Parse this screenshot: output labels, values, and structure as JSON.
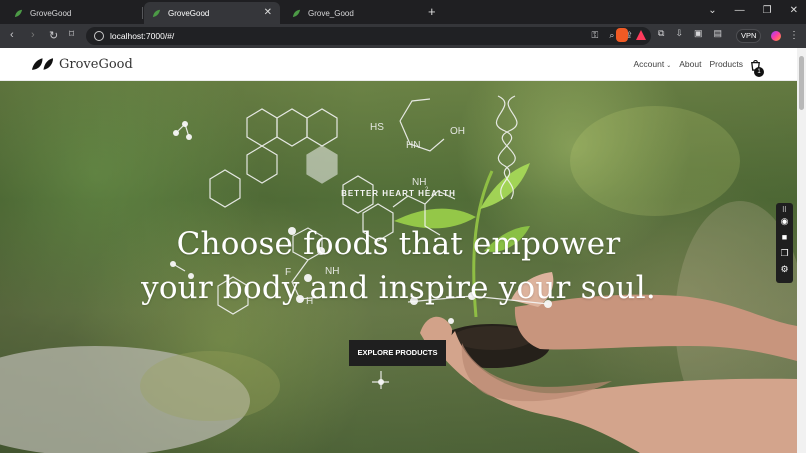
{
  "browser": {
    "tabs": [
      {
        "label": "GroveGood",
        "active": false
      },
      {
        "label": "GroveGood",
        "active": true
      },
      {
        "label": "Grove_Good",
        "active": false
      }
    ],
    "new_tab_label": "+",
    "url": "localhost:7000/#/",
    "vpn_label": "VPN",
    "controls": {
      "minimize": "—",
      "restore": "❐",
      "close": "✕",
      "chevron": "⌄",
      "menu": "⋮"
    }
  },
  "site": {
    "brand": "GroveGood",
    "nav": {
      "account": "Account",
      "about": "About",
      "products": "Products"
    },
    "cart_count": "1",
    "hero": {
      "eyebrow": "BETTER HEART HEALTH",
      "headline_line1": "Choose foods that empower",
      "headline_line2": "your body and inspire your soul.",
      "cta": "EXPLORE PRODUCTS"
    }
  },
  "colors": {
    "brand_green": "#5d8f3b",
    "dark": "#1f1f1f"
  }
}
